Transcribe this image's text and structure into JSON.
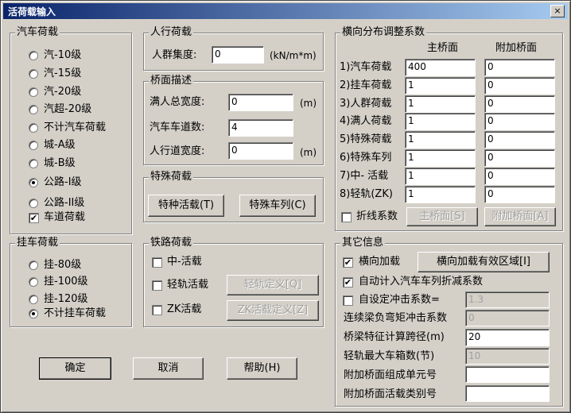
{
  "window": {
    "title": "活荷载输入",
    "close": "×"
  },
  "vehicle": {
    "legend": "汽车荷载",
    "options": [
      "汽-10级",
      "汽-15级",
      "汽-20级",
      "汽超-20级",
      "不计汽车荷载",
      "城-A级",
      "城-B级",
      "公路-I级",
      "公路-II级"
    ],
    "selected": "公路-I级",
    "lane_load_label": "车道荷载",
    "lane_load_checked": true
  },
  "pedestrian": {
    "legend": "人行荷载",
    "density_label": "人群集度:",
    "density_value": "0",
    "density_unit": "(kN/m*m)"
  },
  "deck": {
    "legend": "桥面描述",
    "full_width_label": "满人总宽度:",
    "full_width_value": "0",
    "full_width_unit": "(m)",
    "lanes_label": "汽车车道数:",
    "lanes_value": "4",
    "walk_width_label": "人行道宽度:",
    "walk_width_value": "0",
    "walk_width_unit": "(m)"
  },
  "special": {
    "legend": "特殊荷载",
    "special_live_btn": "特种活载(T)",
    "special_train_btn": "特殊车列(C)"
  },
  "lateral": {
    "legend": "横向分布调整系数",
    "col_main": "主桥面",
    "col_extra": "附加桥面",
    "rows": [
      {
        "label": "1)汽车荷载",
        "main": "400",
        "extra": "0"
      },
      {
        "label": "2)挂车荷载",
        "main": "1",
        "extra": "0"
      },
      {
        "label": "3)人群荷载",
        "main": "1",
        "extra": "0"
      },
      {
        "label": "4)满人荷载",
        "main": "1",
        "extra": "0"
      },
      {
        "label": "5)特殊荷载",
        "main": "1",
        "extra": "0"
      },
      {
        "label": "6)特殊车列",
        "main": "1",
        "extra": "0"
      },
      {
        "label": "7)中- 活载",
        "main": "1",
        "extra": "0"
      },
      {
        "label": "8)轻轨(ZK)",
        "main": "1",
        "extra": "0"
      }
    ],
    "polyline_label": "折线系数",
    "main_deck_btn": "主桥面[S]",
    "extra_deck_btn": "附加桥面[A]"
  },
  "trailer": {
    "legend": "挂车荷载",
    "options": [
      "挂-80级",
      "挂-100级",
      "挂-120级",
      "不计挂车荷载"
    ],
    "selected": "不计挂车荷载"
  },
  "railway": {
    "legend": "铁路荷载",
    "china_live": "中-活载",
    "light_rail": "轻轨活载",
    "light_rail_def_btn": "轻轨定义[Q]",
    "zk_live": "ZK活载",
    "zk_def_btn": "ZK活载定义[Z]"
  },
  "other": {
    "legend": "其它信息",
    "lateral_load_label": "横向加载",
    "lateral_load_checked": true,
    "lateral_region_btn": "横向加载有效区域[I]",
    "auto_reduce_label": "自动计入汽车车列折减系数",
    "auto_reduce_checked": true,
    "impact_label": "自设定冲击系数=",
    "impact_checked": false,
    "impact_value": "1.3",
    "neg_moment_label": "连续梁负弯矩冲击系数",
    "neg_moment_value": "0",
    "span_label": "桥梁特征计算跨径(m)",
    "span_value": "20",
    "rail_axle_label": "轻轨最大车箱数(节)",
    "rail_axle_value": "10",
    "extra_unit_label": "附加桥面组成单元号",
    "extra_unit_value": "",
    "extra_type_label": "附加桥面活载类别号",
    "extra_type_value": ""
  },
  "buttons": {
    "ok": "确定",
    "cancel": "取消",
    "help": "帮助(H)"
  }
}
